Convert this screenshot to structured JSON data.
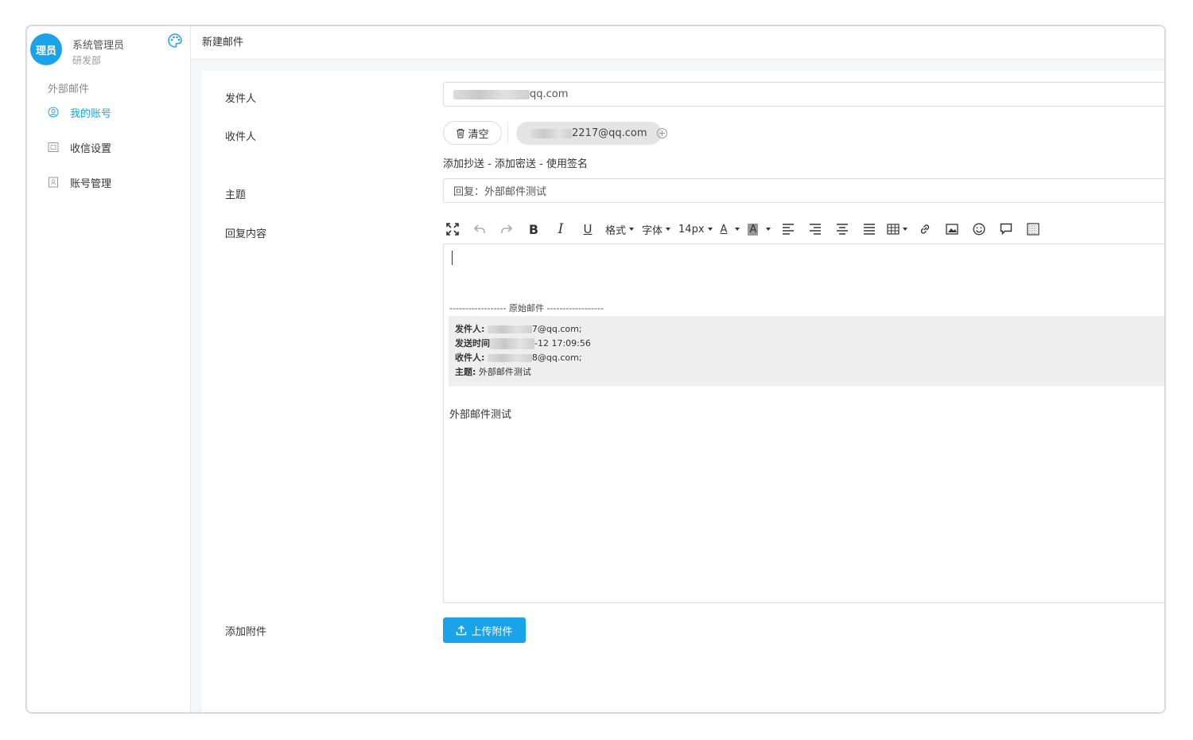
{
  "user": {
    "avatar_text": "理员",
    "name": "系统管理员",
    "dept": "研发部"
  },
  "sidebar": {
    "section_title": "外部邮件",
    "items": [
      {
        "label": "我的账号",
        "icon": "user-icon",
        "active": true
      },
      {
        "label": "收信设置",
        "icon": "inbox-settings-icon",
        "active": false
      },
      {
        "label": "账号管理",
        "icon": "account-manage-icon",
        "active": false
      }
    ]
  },
  "header": {
    "title": "新建邮件"
  },
  "form": {
    "sender_label": "发件人",
    "sender_value_suffix": "qq.com",
    "recipient_label": "收件人",
    "clear_label": "清空",
    "recipient_chip_suffix": "2217@qq.com",
    "cc_link": "添加抄送",
    "bcc_link": "添加密送",
    "signature_link": "使用签名",
    "link_separator": " - ",
    "subject_label": "主题",
    "subject_value": "回复：外部邮件测试",
    "content_label": "回复内容",
    "attachment_label": "添加附件",
    "upload_label": "上传附件"
  },
  "toolbar": {
    "format_label": "格式",
    "font_label": "字体",
    "size_label": "14px",
    "font_color_label": "A",
    "bg_color_label": "A"
  },
  "editor": {
    "original_header": "------------------ 原始邮件 ------------------",
    "quote": {
      "from_label": "发件人:",
      "from_value_suffix": "7@qq.com;",
      "time_label": "发送时间",
      "time_value_suffix": "-12 17:09:56",
      "to_label": "收件人:",
      "to_value_suffix": "8@qq.com;",
      "subject_label": "主题:",
      "subject_value": "外部邮件测试"
    },
    "body_text": "外部邮件测试"
  },
  "colors": {
    "accent": "#1aa3e8",
    "quote_bg": "#eeeeee",
    "chip_bg": "#e4e4e4"
  }
}
